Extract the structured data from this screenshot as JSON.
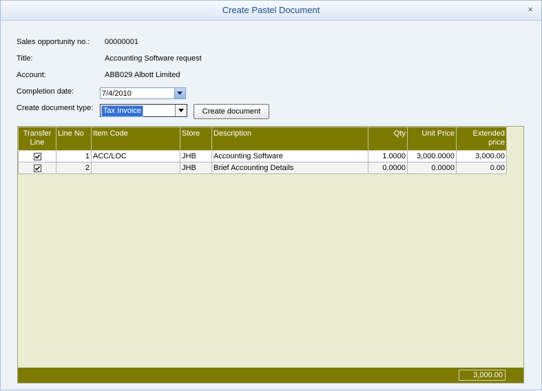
{
  "window": {
    "title": "Create Pastel Document",
    "close_glyph": "×"
  },
  "form": {
    "opportunity_label": "Sales opportunity no.:",
    "opportunity_value": "00000001",
    "title_label": "Title:",
    "title_value": "Accounting Software request",
    "account_label": "Account:",
    "account_value": "ABB029 Albott Limited",
    "completion_label": "Completion date:",
    "completion_value": "7/4/2010",
    "doc_type_label": "Create document type:",
    "doc_type_value": "Tax Invoice",
    "create_button": "Create document"
  },
  "grid": {
    "columns": [
      "Transfer Line",
      "Line No",
      "Item Code",
      "Store",
      "Description",
      "Qty",
      "Unit Price",
      "Extended price"
    ],
    "rows": [
      {
        "transfer": true,
        "line_no": "1",
        "item_code": "ACC/LOC",
        "store": "JHB",
        "description": "Accounting Software",
        "qty": "1.0000",
        "unit_price": "3,000.0000",
        "extended": "3,000.00"
      },
      {
        "transfer": true,
        "line_no": "2",
        "item_code": "",
        "store": "JHB",
        "description": "Brief Accounting Details",
        "qty": "0.0000",
        "unit_price": "0.0000",
        "extended": "0.00"
      }
    ],
    "total": "3,000.00"
  },
  "colors": {
    "header_bg": "#7d7a00",
    "grid_bg": "#eaedd1",
    "title_color": "#1f4f8f"
  }
}
